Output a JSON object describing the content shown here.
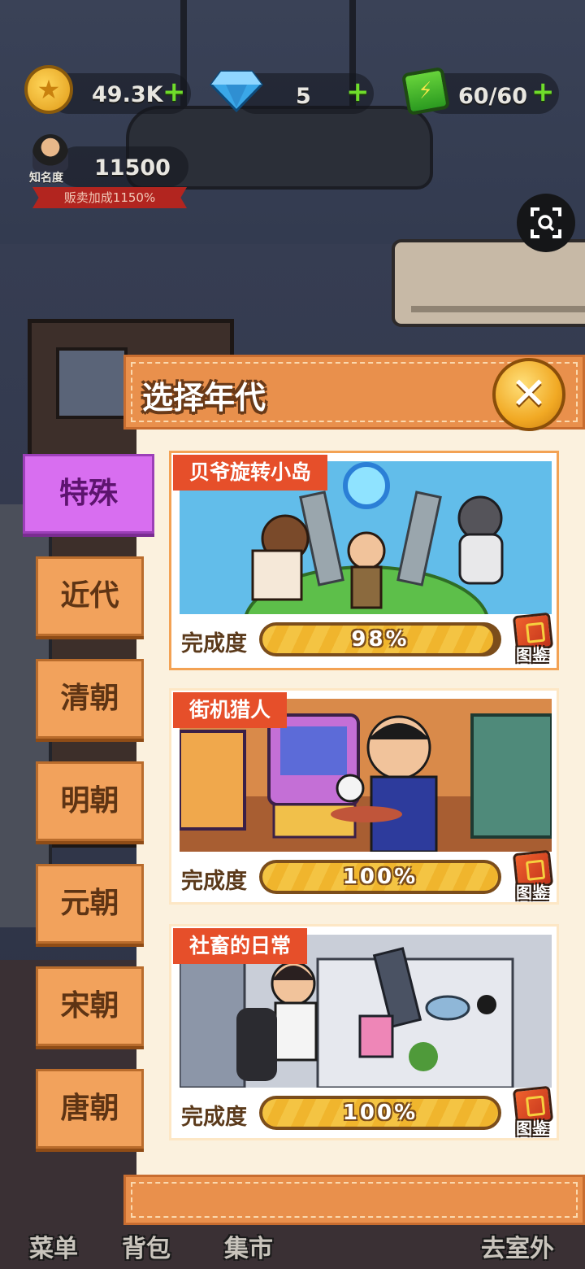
{
  "hud": {
    "coins": "49.3K",
    "gems": "5",
    "energy": "60/60",
    "fame_label": "知名度",
    "fame_value": "11500",
    "sell_bonus": "贩卖加成1150%",
    "plus": "+"
  },
  "dialog": {
    "title": "选择年代"
  },
  "eras": [
    "特殊",
    "近代",
    "清朝",
    "明朝",
    "元朝",
    "宋朝",
    "唐朝"
  ],
  "levels": [
    {
      "name": "贝爷旋转小岛",
      "progress_label": "完成度",
      "progress_text": "98%",
      "progress": 0.98,
      "book_label": "图鉴"
    },
    {
      "name": "街机猎人",
      "progress_label": "完成度",
      "progress_text": "100%",
      "progress": 1.0,
      "book_label": "图鉴"
    },
    {
      "name": "社畜的日常",
      "progress_label": "完成度",
      "progress_text": "100%",
      "progress": 1.0,
      "book_label": "图鉴"
    }
  ],
  "nav": {
    "menu": "菜单",
    "bag": "背包",
    "market": "集市",
    "outdoor": "去室外"
  },
  "colors": {
    "active_tab": "#d86ef0",
    "tab": "#f2a25c",
    "panel": "#fbf1de",
    "title_bar": "#e9904c",
    "tag": "#e64f2a"
  }
}
